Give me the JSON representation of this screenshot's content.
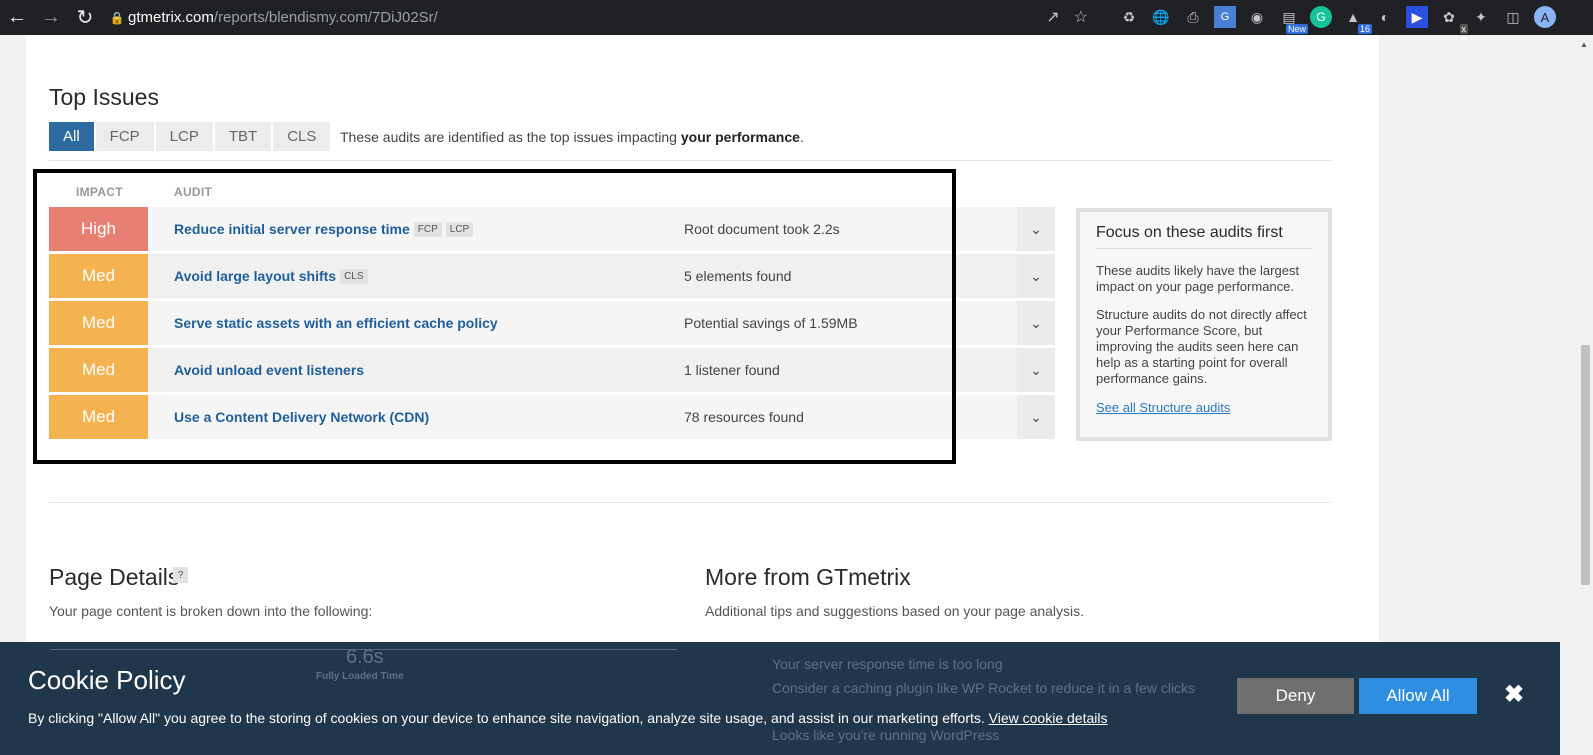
{
  "browser": {
    "domain": "gtmetrix.com",
    "path": "/reports/blendismy.com/7DiJ02Sr/",
    "avatar_letter": "A",
    "ext_badges": {
      "new": "New",
      "count": "16",
      "x": "x"
    }
  },
  "top_issues": {
    "title": "Top Issues",
    "tabs": [
      "All",
      "FCP",
      "LCP",
      "TBT",
      "CLS"
    ],
    "note_prefix": "These audits are identified as the top issues impacting ",
    "note_bold": "your performance",
    "note_suffix": ".",
    "col_impact": "IMPACT",
    "col_audit": "AUDIT",
    "rows": [
      {
        "impact": "High",
        "audit": "Reduce initial server response time",
        "tags": [
          "FCP",
          "LCP"
        ],
        "result": "Root document took 2.2s"
      },
      {
        "impact": "Med",
        "audit": "Avoid large layout shifts",
        "tags": [
          "CLS"
        ],
        "result": "5 elements found"
      },
      {
        "impact": "Med",
        "audit": "Serve static assets with an efficient cache policy",
        "tags": [],
        "result": "Potential savings of 1.59MB"
      },
      {
        "impact": "Med",
        "audit": "Avoid unload event listeners",
        "tags": [],
        "result": "1 listener found"
      },
      {
        "impact": "Med",
        "audit": "Use a Content Delivery Network (CDN)",
        "tags": [],
        "result": "78 resources found"
      }
    ]
  },
  "focus": {
    "title": "Focus on these audits first",
    "p1": "These audits likely have the largest impact on your page performance.",
    "p2": "Structure audits do not directly affect your Performance Score, but improving the audits seen here can help as a starting point for overall performance gains.",
    "link": "See all Structure audits"
  },
  "page_details": {
    "title": "Page Details",
    "help": "?",
    "subtitle": "Your page content is broken down into the following:"
  },
  "more": {
    "title": "More from GTmetrix",
    "subtitle": "Additional tips and suggestions based on your page analysis."
  },
  "obscured": {
    "fully_loaded": "6.6s",
    "fully_loaded_label": "Fully Loaded Time",
    "tip1": "Your server response time is too long",
    "tip1_sub": "Consider a caching plugin like WP Rocket to reduce it in a few clicks",
    "tip2": "Looks like you're running WordPress"
  },
  "cookie": {
    "title": "Cookie Policy",
    "message": "By clicking \"Allow All\" you agree to the storing of cookies on your device to enhance site navigation, analyze site usage, and assist in our marketing efforts.",
    "link": "View cookie details",
    "deny": "Deny",
    "allow": "Allow All",
    "close": "✖"
  }
}
